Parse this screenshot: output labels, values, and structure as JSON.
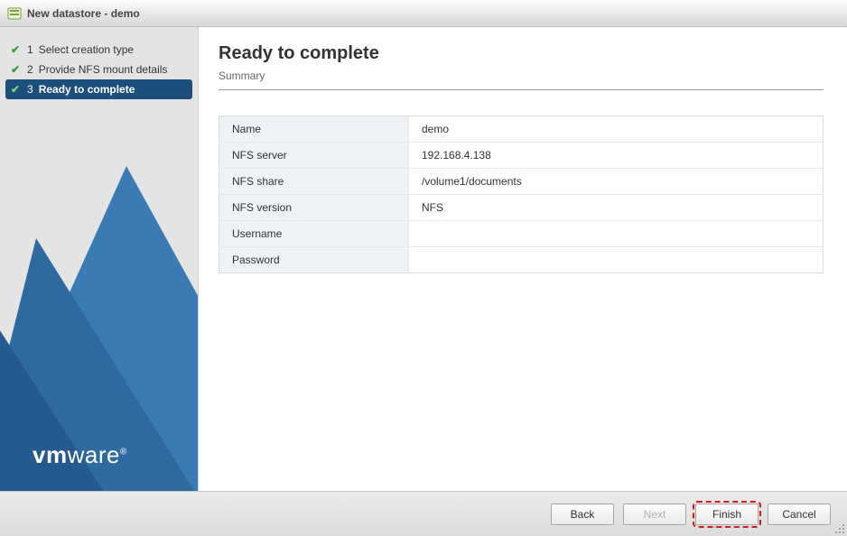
{
  "window": {
    "title": "New datastore - demo"
  },
  "sidebar": {
    "steps": [
      {
        "num": "1",
        "label": "Select creation type",
        "completed": true
      },
      {
        "num": "2",
        "label": "Provide NFS mount details",
        "completed": true
      },
      {
        "num": "3",
        "label": "Ready to complete",
        "completed": true,
        "active": true
      }
    ],
    "logo": "vmware"
  },
  "main": {
    "heading": "Ready to complete",
    "subheading": "Summary",
    "rows": [
      {
        "key": "Name",
        "value": "demo"
      },
      {
        "key": "NFS server",
        "value": "192.168.4.138"
      },
      {
        "key": "NFS share",
        "value": "/volume1/documents"
      },
      {
        "key": "NFS version",
        "value": "NFS"
      },
      {
        "key": "Username",
        "value": ""
      },
      {
        "key": "Password",
        "value": ""
      }
    ]
  },
  "footer": {
    "back": "Back",
    "next": "Next",
    "finish": "Finish",
    "cancel": "Cancel"
  }
}
